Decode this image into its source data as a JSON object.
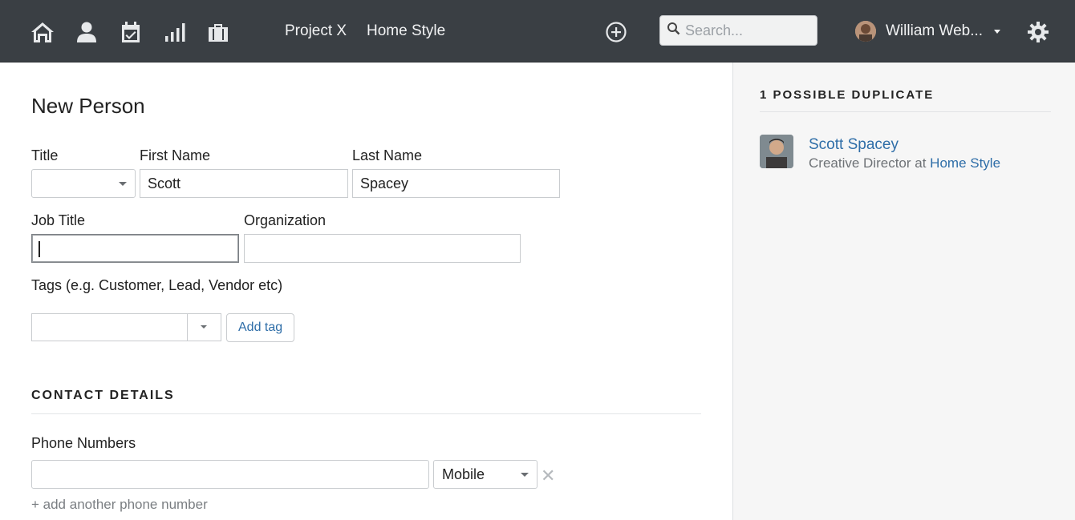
{
  "topbar": {
    "icons": [
      "home-icon",
      "person-icon",
      "calendar-check-icon",
      "reports-icon",
      "briefcase-icon",
      "add-circle-icon",
      "search-icon",
      "gear-icon"
    ],
    "nav_links": [
      "Project X",
      "Home Style"
    ],
    "search_placeholder": "Search...",
    "user_name": "William Web..."
  },
  "form": {
    "title": "New Person",
    "title_label": "Title",
    "first_name_label": "First Name",
    "first_name_value": "Scott",
    "last_name_label": "Last Name",
    "last_name_value": "Spacey",
    "job_title_label": "Job Title",
    "job_title_value": "",
    "organization_label": "Organization",
    "organization_value": "",
    "tags_label": "Tags (e.g. Customer, Lead, Vendor etc)",
    "add_tag_label": "Add tag",
    "contact_section": "CONTACT DETAILS",
    "phone_label": "Phone Numbers",
    "phone_value": "",
    "phone_type": "Mobile",
    "remove_symbol": "✕",
    "add_phone_label": "+ add another phone number"
  },
  "sidebar": {
    "title": "1 POSSIBLE DUPLICATE",
    "duplicate": {
      "name": "Scott Spacey",
      "role_prefix": "Creative Director at",
      "organization": "Home Style"
    }
  },
  "colors": {
    "topbar_bg": "#3a3f44",
    "link": "#2f6ea8",
    "sidebar_bg": "#f6f6f6"
  }
}
